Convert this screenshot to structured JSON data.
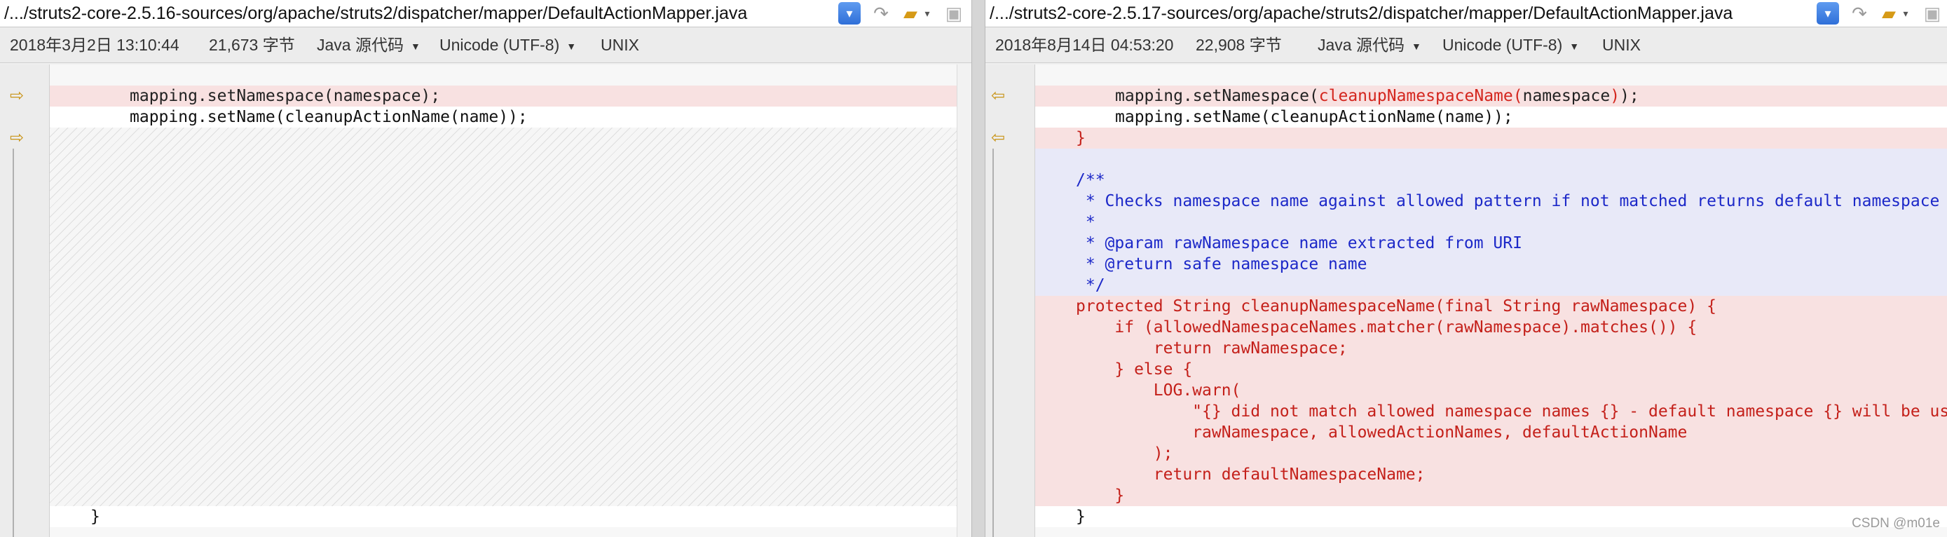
{
  "left": {
    "path": "/.../struts2-core-2.5.16-sources/org/apache/struts2/dispatcher/mapper/DefaultActionMapper.java",
    "date": "2018年3月2日 13:10:44",
    "size": "21,673 字节",
    "language": "Java 源代码",
    "encoding": "Unicode (UTF-8)",
    "line_ending": "UNIX",
    "code": {
      "line1": "mapping.setNamespace(namespace);",
      "line2": "mapping.setName(cleanupActionName(name));",
      "closing": "}"
    }
  },
  "right": {
    "path": "/.../struts2-core-2.5.17-sources/org/apache/struts2/dispatcher/mapper/DefaultActionMapper.java",
    "date": "2018年8月14日 04:53:20",
    "size": "22,908 字节",
    "language": "Java 源代码",
    "encoding": "Unicode (UTF-8)",
    "line_ending": "UNIX",
    "code": {
      "l1_pre": "mapping.setNamespace(",
      "l1_hl": "cleanupNamespaceName(",
      "l1_mid": "namespace",
      "l1_hl2": ")",
      "l1_post": ");",
      "l2": "mapping.setName(cleanupActionName(name));",
      "l3": "}",
      "l5": "/**",
      "l6": " * Checks namespace name against allowed pattern if not matched returns default namespace",
      "l7": " *",
      "l8": " * @param rawNamespace name extracted from URI",
      "l9": " * @return safe namespace name",
      "l10": " */",
      "l11": "protected String cleanupNamespaceName(final String rawNamespace) {",
      "l12": "    if (allowedNamespaceNames.matcher(rawNamespace).matches()) {",
      "l13": "        return rawNamespace;",
      "l14": "    } else {",
      "l15": "        LOG.warn(",
      "l16": "            \"{} did not match allowed namespace names {} - default namespace {} will be used!\",",
      "l17": "            rawNamespace, allowedActionNames, defaultActionName",
      "l18": "        );",
      "l19": "        return defaultNamespaceName;",
      "l20": "    }",
      "l21": "}"
    }
  },
  "icons": {
    "dropdown": "chevron-down-icon",
    "merge": "merge-arrow-icon",
    "folder": "folder-icon",
    "save": "save-icon",
    "diff_arrow_right": "diff-arrow-right-icon",
    "diff_arrow_left": "diff-arrow-left-icon"
  },
  "colors": {
    "changed_bg": "#f8e1e1",
    "added_text": "#c4201a",
    "comment_bg": "#e8e9f8",
    "comment_text": "#1c28c8",
    "accent": "#2f6fd8"
  },
  "watermark": "CSDN @m01e"
}
